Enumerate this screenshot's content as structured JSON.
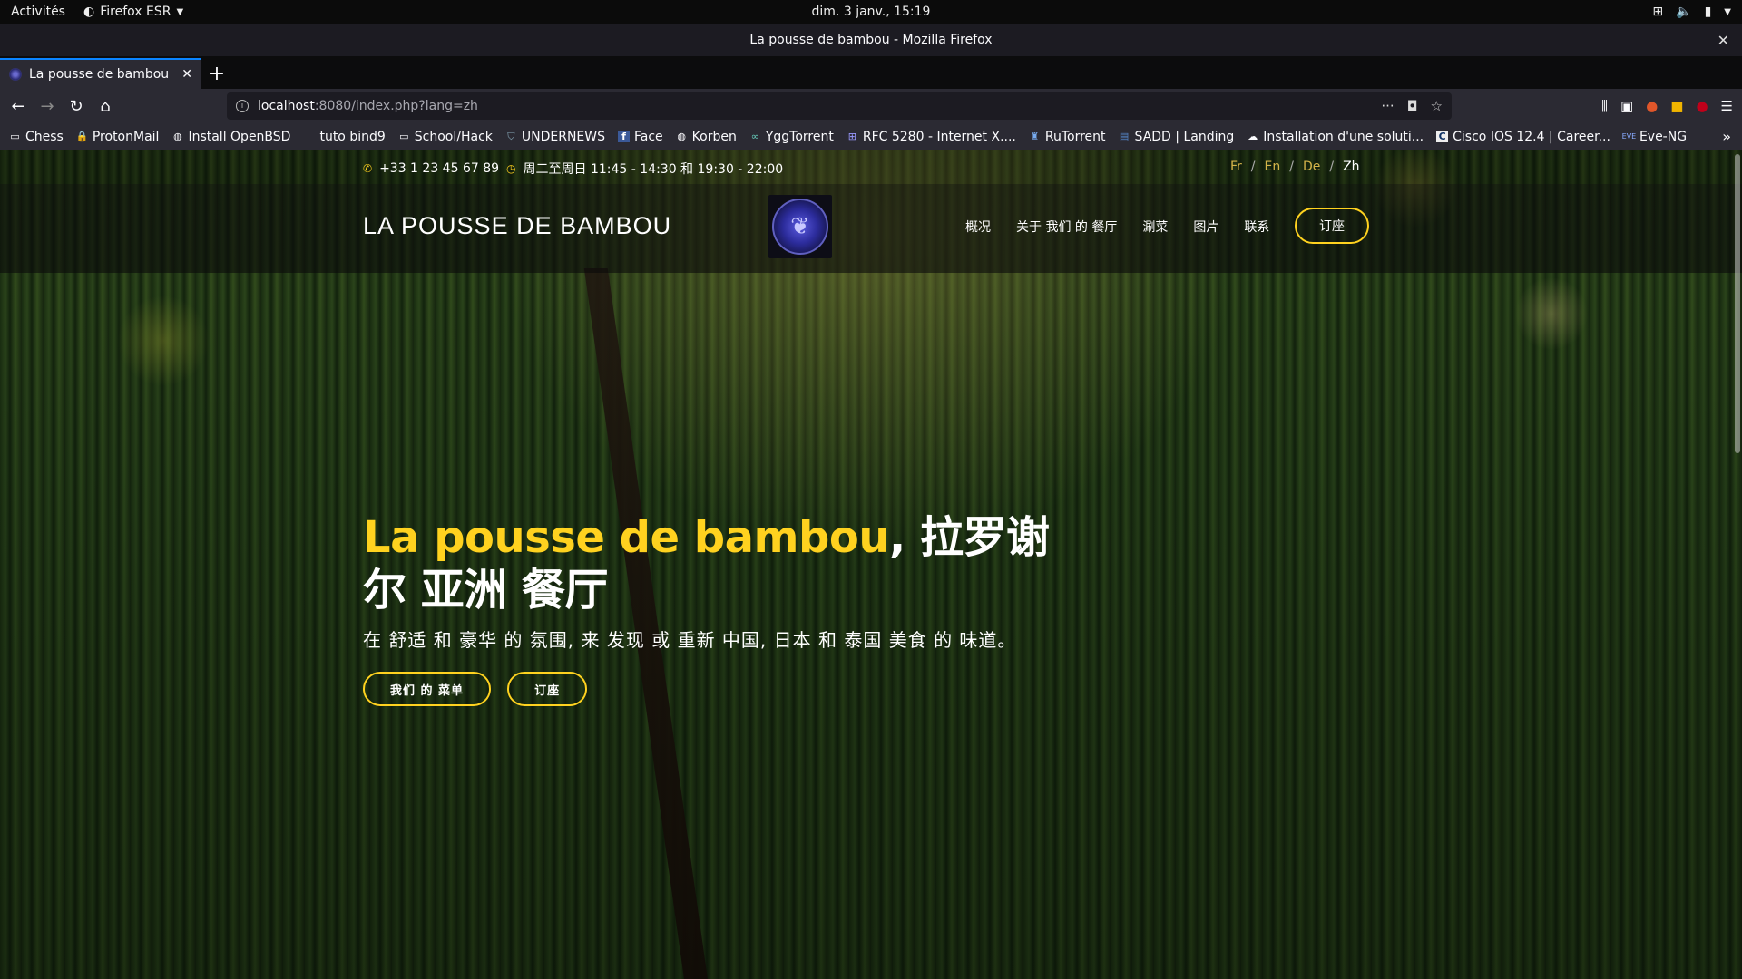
{
  "gnome": {
    "activities": "Activités",
    "app_menu": "Firefox ESR",
    "clock": "dim.  3 janv., 15:19"
  },
  "window": {
    "title": "La pousse de bambou - Mozilla Firefox"
  },
  "tabs": [
    {
      "title": "La pousse de bambou"
    }
  ],
  "urlbar": {
    "host": "localhost",
    "path": ":8080/index.php?lang=zh"
  },
  "bookmarks": [
    {
      "label": "Chess",
      "icon": "folder-icon"
    },
    {
      "label": "ProtonMail",
      "icon": "lock-icon"
    },
    {
      "label": "Install OpenBSD",
      "icon": "globe-icon"
    },
    {
      "label": "tuto bind9",
      "icon": "blank-icon"
    },
    {
      "label": "School/Hack",
      "icon": "folder-icon"
    },
    {
      "label": "UNDERNEWS",
      "icon": "shield-icon"
    },
    {
      "label": "Face",
      "icon": "facebook-icon"
    },
    {
      "label": "Korben",
      "icon": "globe-icon"
    },
    {
      "label": "YggTorrent",
      "icon": "ygg-icon"
    },
    {
      "label": "RFC 5280 - Internet X....",
      "icon": "ietf-icon"
    },
    {
      "label": "RuTorrent",
      "icon": "rutorrent-icon"
    },
    {
      "label": "SADD | Landing",
      "icon": "sadd-icon"
    },
    {
      "label": "Installation d'une soluti...",
      "icon": "cloud-icon"
    },
    {
      "label": "Cisco IOS 12.4 | Career...",
      "icon": "c-icon"
    },
    {
      "label": "Eve-NG",
      "icon": "eve-icon"
    }
  ],
  "site": {
    "phone": "+33 1 23 45 67 89",
    "hours": "周二至周日 11:45 - 14:30 和 19:30 - 22:00",
    "langs": [
      "Fr",
      "En",
      "De",
      "Zh"
    ],
    "active_lang": "Zh",
    "brand": "LA POUSSE DE BAMBOU",
    "nav": [
      "概况",
      "关于 我们 的 餐厅",
      "涮菜",
      "图片",
      "联系"
    ],
    "book_label": "订座",
    "hero_title_accent": "La pousse de bambou",
    "hero_title_rest": ", 拉罗谢尔 亚洲 餐厅",
    "hero_subtitle": "在 舒适 和 豪华 的 氛围, 来 发现 或 重新 中国, 日本 和 泰国 美食 的 味道。",
    "btn_menu": "我们 的 菜单",
    "btn_book": "订座"
  }
}
